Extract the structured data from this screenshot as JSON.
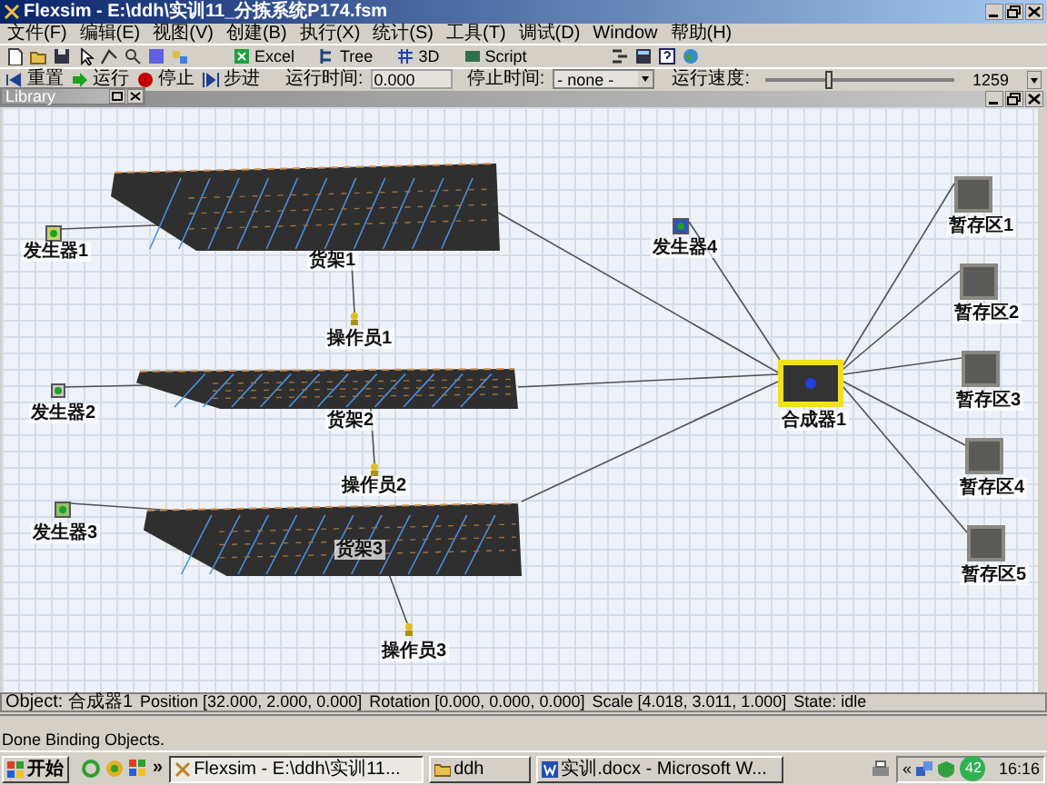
{
  "window": {
    "title": "Flexsim - E:\\ddh\\实训11_分拣系统P174.fsm"
  },
  "menu": [
    "文件(F)",
    "编辑(E)",
    "视图(V)",
    "创建(B)",
    "执行(X)",
    "统计(S)",
    "工具(T)",
    "调试(D)",
    "Window",
    "帮助(H)"
  ],
  "toolbar_buttons": [
    "Excel",
    "Tree",
    "3D",
    "Script"
  ],
  "run_bar": {
    "buttons": [
      "重置",
      "运行",
      "停止",
      "步进"
    ],
    "run_time_label": "运行时间:",
    "run_time": "0.000",
    "stop_time_label": "停止时间:",
    "stop_time": "- none -",
    "speed_label": "运行速度:",
    "speed": {
      "level": 0.31
    },
    "speed_value": "1259"
  },
  "library_panel": {
    "title": "Library"
  },
  "model_view": {
    "objects": [
      {
        "kind": "source",
        "label": "发生器1",
        "selected": false
      },
      {
        "kind": "rack",
        "label": "货架1",
        "selected": false
      },
      {
        "kind": "operator",
        "label": "操作员1",
        "selected": false
      },
      {
        "kind": "source",
        "label": "发生器2",
        "selected": false
      },
      {
        "kind": "rack",
        "label": "货架2",
        "selected": false
      },
      {
        "kind": "operator",
        "label": "操作员2",
        "selected": false
      },
      {
        "kind": "source",
        "label": "发生器3",
        "selected": false
      },
      {
        "kind": "rack",
        "label": "货架3",
        "selected": false
      },
      {
        "kind": "operator",
        "label": "操作员3",
        "selected": false
      },
      {
        "kind": "source",
        "label": "发生器4",
        "selected": false
      },
      {
        "kind": "combiner",
        "label": "合成器1",
        "selected": true
      },
      {
        "kind": "queue",
        "label": "暂存区1",
        "selected": false
      },
      {
        "kind": "queue",
        "label": "暂存区2",
        "selected": false
      },
      {
        "kind": "queue",
        "label": "暂存区3",
        "selected": false
      },
      {
        "kind": "queue",
        "label": "暂存区4",
        "selected": false
      },
      {
        "kind": "queue",
        "label": "暂存区5",
        "selected": false
      }
    ]
  },
  "object_info": [
    "Object: 合成器1",
    "Position [32.000, 2.000, 0.000]",
    "Rotation [0.000, 0.000, 0.000]",
    "Scale [4.018, 3.011, 1.000]",
    "State: idle"
  ],
  "status_bar": "Done Binding Objects.",
  "taskbar": {
    "start": "开始",
    "more": "»",
    "tasks": [
      {
        "label": "Flexsim - E:\\ddh\\实训11...",
        "selected": true
      },
      {
        "label": "ddh",
        "selected": false
      },
      {
        "label": "实训.docx - Microsoft W...",
        "selected": false
      }
    ],
    "tray_more": "«",
    "badge": "42",
    "clock": "16:16"
  }
}
